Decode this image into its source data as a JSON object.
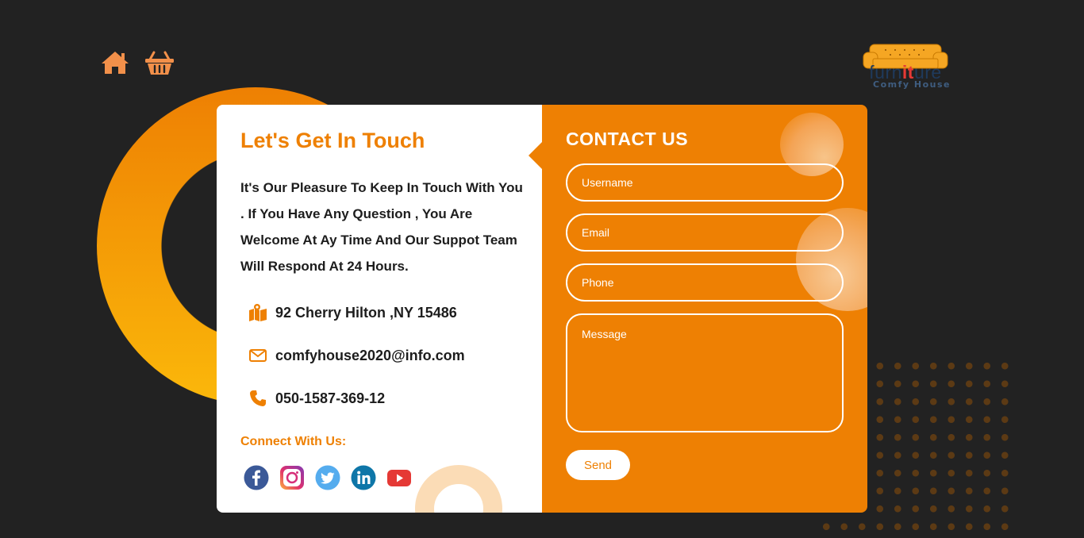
{
  "nav": {
    "home_icon": "home-icon",
    "cart_icon": "basket-icon"
  },
  "logo": {
    "word_prefix": "furn",
    "word_highlight": "it",
    "word_suffix": "ure",
    "tagline": "Comfy House"
  },
  "contact_info": {
    "title": "Let's Get In Touch",
    "description": "It's Our Pleasure To Keep In Touch With You . If You Have Any Question , You Are Welcome At Ay Time And Our Suppot Team Will Respond At 24 Hours.",
    "address": "92 Cherry Hilton ,NY 15486",
    "email": "comfyhouse2020@info.com",
    "phone": "050-1587-369-12",
    "connect_label": "Connect With Us:",
    "socials": [
      "facebook-icon",
      "instagram-icon",
      "twitter-icon",
      "linkedin-icon",
      "youtube-icon"
    ]
  },
  "form": {
    "title": "CONTACT US",
    "username_placeholder": "Username",
    "email_placeholder": "Email",
    "phone_placeholder": "Phone",
    "message_placeholder": "Message",
    "send_label": "Send"
  },
  "colors": {
    "accent": "#ee8003",
    "background": "#222222",
    "card": "#ffffff",
    "ring_light": "#fbb80a",
    "ring_dark": "#ee8003"
  }
}
